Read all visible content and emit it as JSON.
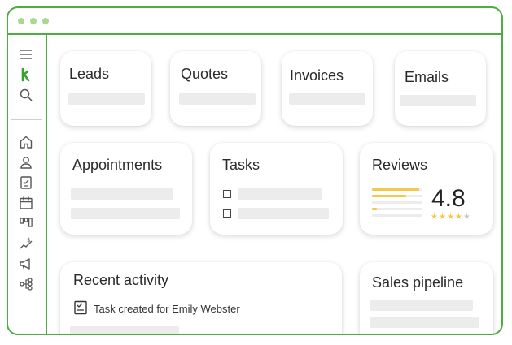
{
  "window": {
    "dots": [
      "dot-1",
      "dot-2",
      "dot-3"
    ]
  },
  "sidebar": {
    "icons": [
      "menu-icon",
      "brand-logo-icon",
      "search-icon",
      "home-icon",
      "user-icon",
      "clipboard-icon",
      "calendar-icon",
      "kanban-icon",
      "sales-trend-icon",
      "megaphone-icon",
      "workflow-icon"
    ],
    "brand_letter": "k"
  },
  "cards": {
    "leads": {
      "title": "Leads"
    },
    "quotes": {
      "title": "Quotes"
    },
    "invoices": {
      "title": "Invoices"
    },
    "emails": {
      "title": "Emails"
    },
    "appointments": {
      "title": "Appointments"
    },
    "tasks": {
      "title": "Tasks"
    },
    "reviews": {
      "title": "Reviews",
      "rating": "4.8",
      "stars_filled": 4,
      "stars_total": 5
    },
    "recent_activity": {
      "title": "Recent activity",
      "item": {
        "icon": "task-clipboard-icon",
        "text": "Task created for Emily Webster"
      }
    },
    "sales_pipeline": {
      "title": "Sales pipeline"
    }
  },
  "colors": {
    "accent_green": "#4cae3f",
    "brand_green": "#3aa12f",
    "star_yellow": "#f2c94c",
    "placeholder_gray": "#ececec"
  }
}
